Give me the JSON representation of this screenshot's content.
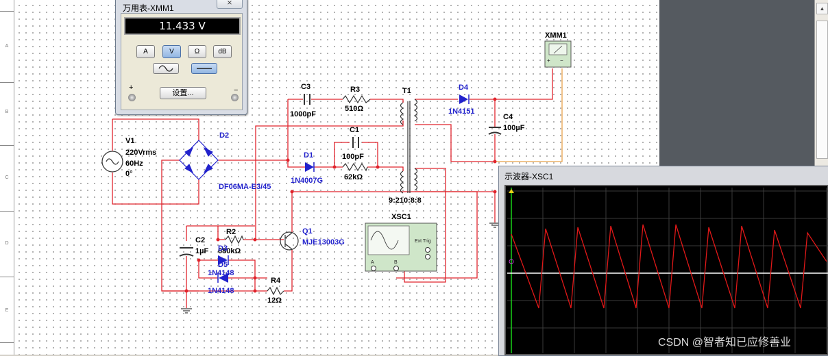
{
  "ruler": {
    "labels": [
      "A",
      "B",
      "C",
      "D",
      "E"
    ]
  },
  "multimeter_window": {
    "title": "万用表-XMM1",
    "close_glyph": "⨯",
    "reading": "11.433 V",
    "modes": [
      "A",
      "V",
      "Ω",
      "dB"
    ],
    "active_mode": "V",
    "plus": "+",
    "minus": "−",
    "settings_label": "设置..."
  },
  "oscilloscope_window": {
    "title": "示波器-XSC1"
  },
  "circuit": {
    "V1": {
      "ref": "V1",
      "value": "220Vrms",
      "freq": "60Hz",
      "phase": "0°"
    },
    "D2": {
      "ref": "D2",
      "part": "DF06MA-E3/45"
    },
    "C3": {
      "ref": "C3",
      "value": "1000pF"
    },
    "R3": {
      "ref": "R3",
      "value": "510Ω"
    },
    "T1": {
      "ref": "T1",
      "ratio": "9:210:8:8"
    },
    "C1": {
      "ref": "C1",
      "value": "100pF"
    },
    "R1": {
      "value": "62kΩ"
    },
    "D1": {
      "ref": "D1",
      "part": "1N4007G"
    },
    "D4": {
      "ref": "D4",
      "part": "1N4151"
    },
    "C4": {
      "ref": "C4",
      "value": "100µF"
    },
    "XMM1": {
      "ref": "XMM1"
    },
    "C2": {
      "ref": "C2",
      "value": "1µF"
    },
    "R2": {
      "ref": "R2",
      "value": "680kΩ"
    },
    "D3": {
      "ref": "D3",
      "part": "1N4148"
    },
    "D5": {
      "ref": "D5",
      "part": "1N4148"
    },
    "Q1": {
      "ref": "Q1",
      "part": "MJE13003G"
    },
    "R4": {
      "ref": "R4",
      "value": "12Ω"
    },
    "XSC1": {
      "ref": "XSC1",
      "ext_trig": "Ext Trig",
      "ch_a": "A",
      "ch_b": "B"
    }
  },
  "watermark": "CSDN @智者知已应修善业",
  "colors": {
    "wire_red": "#e0242c",
    "wire_orange": "#e8a24a",
    "component_blue": "#2222cc",
    "trace_red": "#e01818",
    "trace_white": "#ffffff",
    "screen_black": "#000000"
  }
}
